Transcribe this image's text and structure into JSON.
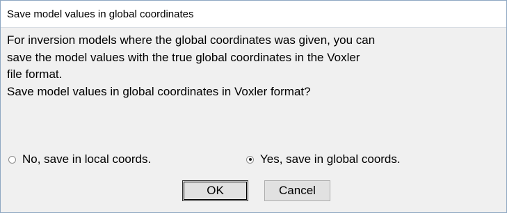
{
  "dialog": {
    "title": "Save model values in global coordinates",
    "message_lines": [
      "For inversion models where the global coordinates was given, you can",
      "save the model values with the true global coordinates in the Voxler",
      "file format.",
      "Save model values in global coordinates in Voxler format?"
    ],
    "options": [
      {
        "label": "No, save in local coords.",
        "checked": false
      },
      {
        "label": "Yes, save in global coords.",
        "checked": true
      }
    ],
    "buttons": {
      "ok": "OK",
      "cancel": "Cancel"
    }
  }
}
